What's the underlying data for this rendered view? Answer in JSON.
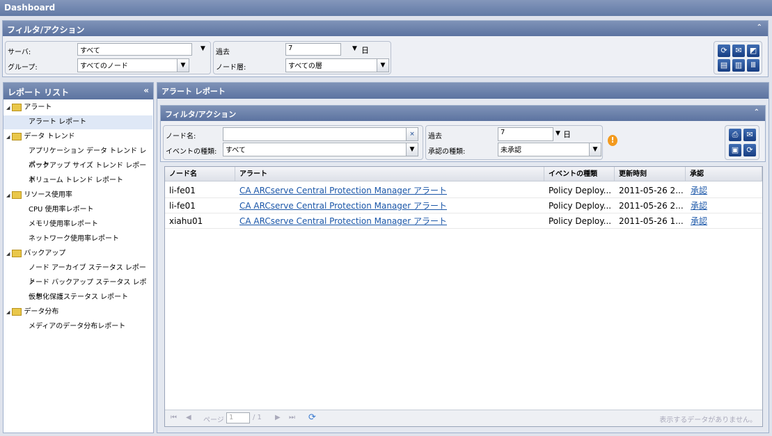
{
  "title": "Dashboard",
  "filter": {
    "header": "フィルタ/アクション",
    "server_label": "サーバ:",
    "server_value": "すべて",
    "group_label": "グループ:",
    "group_value": "すべてのノード",
    "past_label": "過去",
    "past_value": "7",
    "day_label": "日",
    "tier_label": "ノード層:",
    "tier_value": "すべての層"
  },
  "toolbar_icons": [
    "refresh-icon",
    "email-icon",
    "export-icon",
    "layout-single-icon",
    "layout-two-column-icon",
    "layout-three-column-icon"
  ],
  "sidebar": {
    "header": "レポート リスト",
    "groups": [
      {
        "label": "アラート",
        "items": [
          "アラート レポート"
        ]
      },
      {
        "label": "データ トレンド",
        "items": [
          "アプリケーション データ トレンド レポート",
          "バックアップ サイズ トレンド レポート",
          "ボリューム トレンド レポート"
        ]
      },
      {
        "label": "リソース使用率",
        "items": [
          "CPU 使用率レポート",
          "メモリ使用率レポート",
          "ネットワーク使用率レポート"
        ]
      },
      {
        "label": "バックアップ",
        "items": [
          "ノード アーカイブ ステータス レポート",
          "ノード バックアップ ステータス レポート",
          "仮想化保護ステータス レポート"
        ]
      },
      {
        "label": "データ分布",
        "items": [
          "メディアのデータ分布レポート"
        ]
      }
    ]
  },
  "main": {
    "header": "アラート レポート",
    "filter": {
      "header": "フィルタ/アクション",
      "node_label": "ノード名:",
      "node_value": "",
      "event_label": "イベントの種類:",
      "event_value": "すべて",
      "past_label": "過去",
      "past_value": "7",
      "day_label": "日",
      "approval_label": "承認の種類:",
      "approval_value": "未承認"
    },
    "columns": [
      "ノード名",
      "アラート",
      "イベントの種類",
      "更新時刻",
      "承認"
    ],
    "rows": [
      [
        "li-fe01",
        "CA ARCserve Central Protection Manager アラート",
        "Policy Deploy...",
        "2011-05-26 2...",
        "承認"
      ],
      [
        "li-fe01",
        "CA ARCserve Central Protection Manager アラート",
        "Policy Deploy...",
        "2011-05-26 2...",
        "承認"
      ],
      [
        "xiahu01",
        "CA ARCserve Central Protection Manager アラート",
        "Policy Deploy...",
        "2011-05-26 1...",
        "承認"
      ]
    ],
    "paging": {
      "page_label": "ページ",
      "page_value": "1",
      "page_total": "/ 1",
      "status": "表示するデータがありません。"
    }
  }
}
